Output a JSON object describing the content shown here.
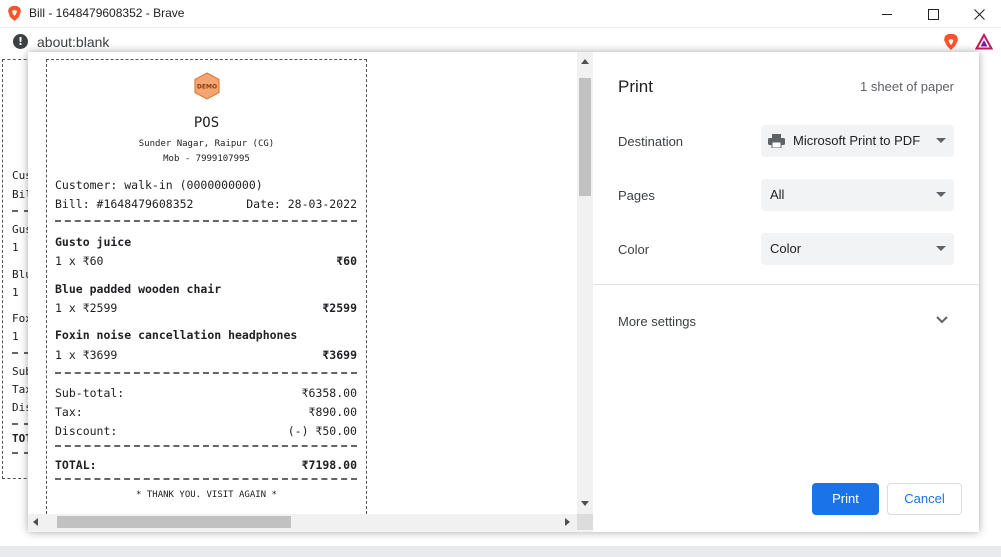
{
  "window": {
    "title": "Bill - 1648479608352 - Brave",
    "url": "about:blank"
  },
  "background_page": {
    "visible_fragments": [
      "Cus",
      "Bil",
      "Gus",
      "1 ",
      "Blu",
      "1 ",
      "Fox",
      "1 ",
      "Sub",
      "Tax",
      "Dis",
      "TOT"
    ]
  },
  "receipt": {
    "logo_text": "DEMO",
    "store_name": "POS",
    "address": "Sunder Nagar, Raipur (CG)",
    "mobile": "Mob - 7999107995",
    "customer": "Customer: walk-in (0000000000)",
    "bill_no": "Bill: #1648479608352",
    "date": "Date: 28-03-2022",
    "items": [
      {
        "name": "Gusto juice",
        "qty_price": "1 x ₹60",
        "total": "₹60"
      },
      {
        "name": "Blue padded wooden chair",
        "qty_price": "1 x ₹2599",
        "total": "₹2599"
      },
      {
        "name": "Foxin noise cancellation headphones",
        "qty_price": "1 x ₹3699",
        "total": "₹3699"
      }
    ],
    "subtotal_label": "Sub-total:",
    "subtotal_value": "₹6358.00",
    "tax_label": "Tax:",
    "tax_value": "₹890.00",
    "discount_label": "Discount:",
    "discount_value": "(-) ₹50.00",
    "total_label": "TOTAL:",
    "total_value": "₹7198.00",
    "thanks": "* THANK YOU. VISIT AGAIN *"
  },
  "print_dialog": {
    "title": "Print",
    "sheet_count": "1 sheet of paper",
    "destination_label": "Destination",
    "destination_value": "Microsoft Print to PDF",
    "pages_label": "Pages",
    "pages_value": "All",
    "color_label": "Color",
    "color_value": "Color",
    "more_settings": "More settings",
    "print_button": "Print",
    "cancel_button": "Cancel"
  },
  "colors": {
    "primary": "#1a73e8",
    "brave_orange": "#fb542b",
    "logo_orange": "#f4a672"
  },
  "icons": [
    "brave-logo-icon",
    "minimize-icon",
    "maximize-icon",
    "close-icon",
    "info-icon",
    "brave-shield-icon",
    "brave-rewards-icon",
    "printer-icon",
    "chevron-down-icon"
  ]
}
